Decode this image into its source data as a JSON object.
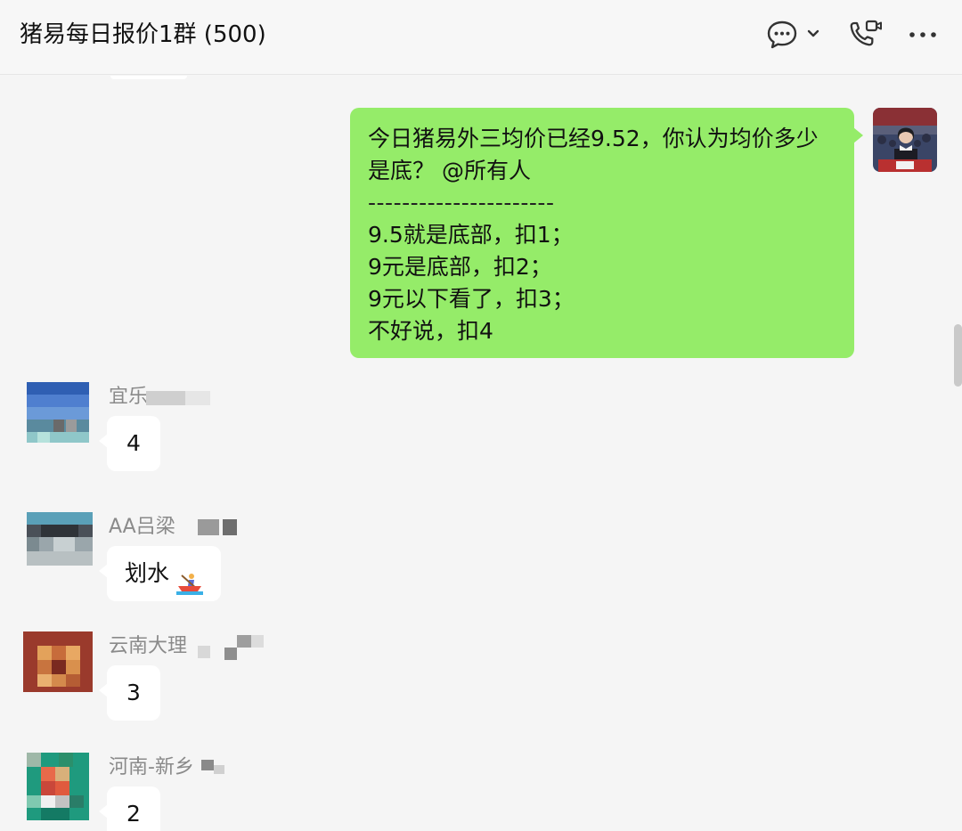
{
  "header": {
    "title": "猪易每日报价1群 (500)",
    "icons": [
      "chat-bubble-icon",
      "chevron-down-icon",
      "phone-video-icon",
      "more-icon"
    ]
  },
  "self_message": {
    "lines": [
      "今日猪易外三均价已经9.52，你认为均价多少",
      "是底？ @所有人",
      "----------------------",
      "9.5就是底部，扣1；",
      "9元是底部，扣2；",
      "9元以下看了，扣3；",
      "不好说，扣4"
    ],
    "bubble_color": "#95ec69"
  },
  "messages": [
    {
      "sender": "宜乐",
      "text": "4"
    },
    {
      "sender": "AA吕梁",
      "text": "划水"
    },
    {
      "sender": "云南大理",
      "text": "3"
    },
    {
      "sender": "河南-新乡",
      "text": "2"
    }
  ],
  "colors": {
    "background": "#f5f5f5",
    "header_bg": "#f7f7f7",
    "incoming_bubble": "#ffffff",
    "sender_name": "#8a8a8a"
  }
}
